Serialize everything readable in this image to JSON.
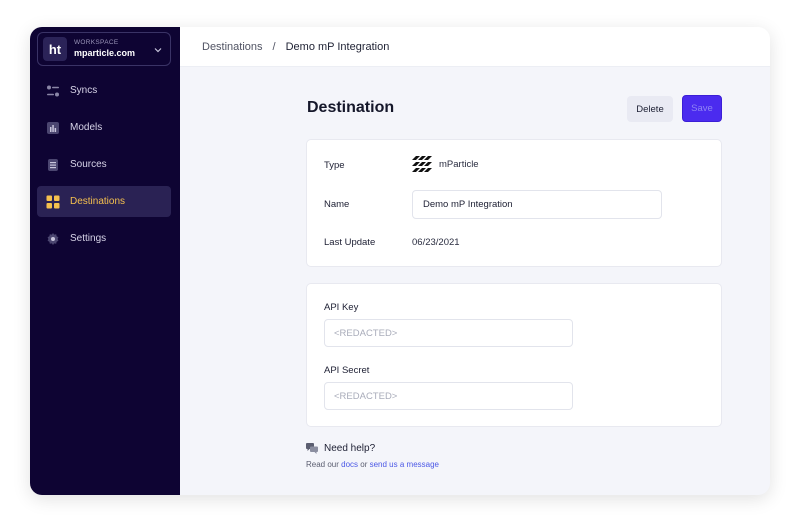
{
  "workspace": {
    "logo_text": "ht",
    "label": "WORKSPACE",
    "name": "mparticle.com"
  },
  "nav": {
    "items": [
      {
        "label": "Syncs",
        "icon": "syncs-icon"
      },
      {
        "label": "Models",
        "icon": "models-icon"
      },
      {
        "label": "Sources",
        "icon": "sources-icon"
      },
      {
        "label": "Destinations",
        "icon": "destinations-icon",
        "active": true
      },
      {
        "label": "Settings",
        "icon": "gear-icon"
      }
    ]
  },
  "breadcrumb": {
    "parent": "Destinations",
    "separator": "/",
    "current": "Demo mP Integration"
  },
  "page": {
    "title": "Destination",
    "delete_label": "Delete",
    "save_label": "Save"
  },
  "details": {
    "type_label": "Type",
    "type_value": "mParticle",
    "name_label": "Name",
    "name_value": "Demo mP Integration",
    "last_update_label": "Last Update",
    "last_update_value": "06/23/2021"
  },
  "credentials": {
    "api_key_label": "API Key",
    "api_key_placeholder": "<REDACTED>",
    "api_secret_label": "API Secret",
    "api_secret_placeholder": "<REDACTED>"
  },
  "help": {
    "title": "Need help?",
    "prefix": "Read our ",
    "docs_link": "docs",
    "middle": " or ",
    "message_link": "send us a message"
  },
  "colors": {
    "sidebar_bg": "#0e0433",
    "accent": "#f5c04e",
    "primary": "#4b2bef",
    "link": "#4b58e6"
  }
}
